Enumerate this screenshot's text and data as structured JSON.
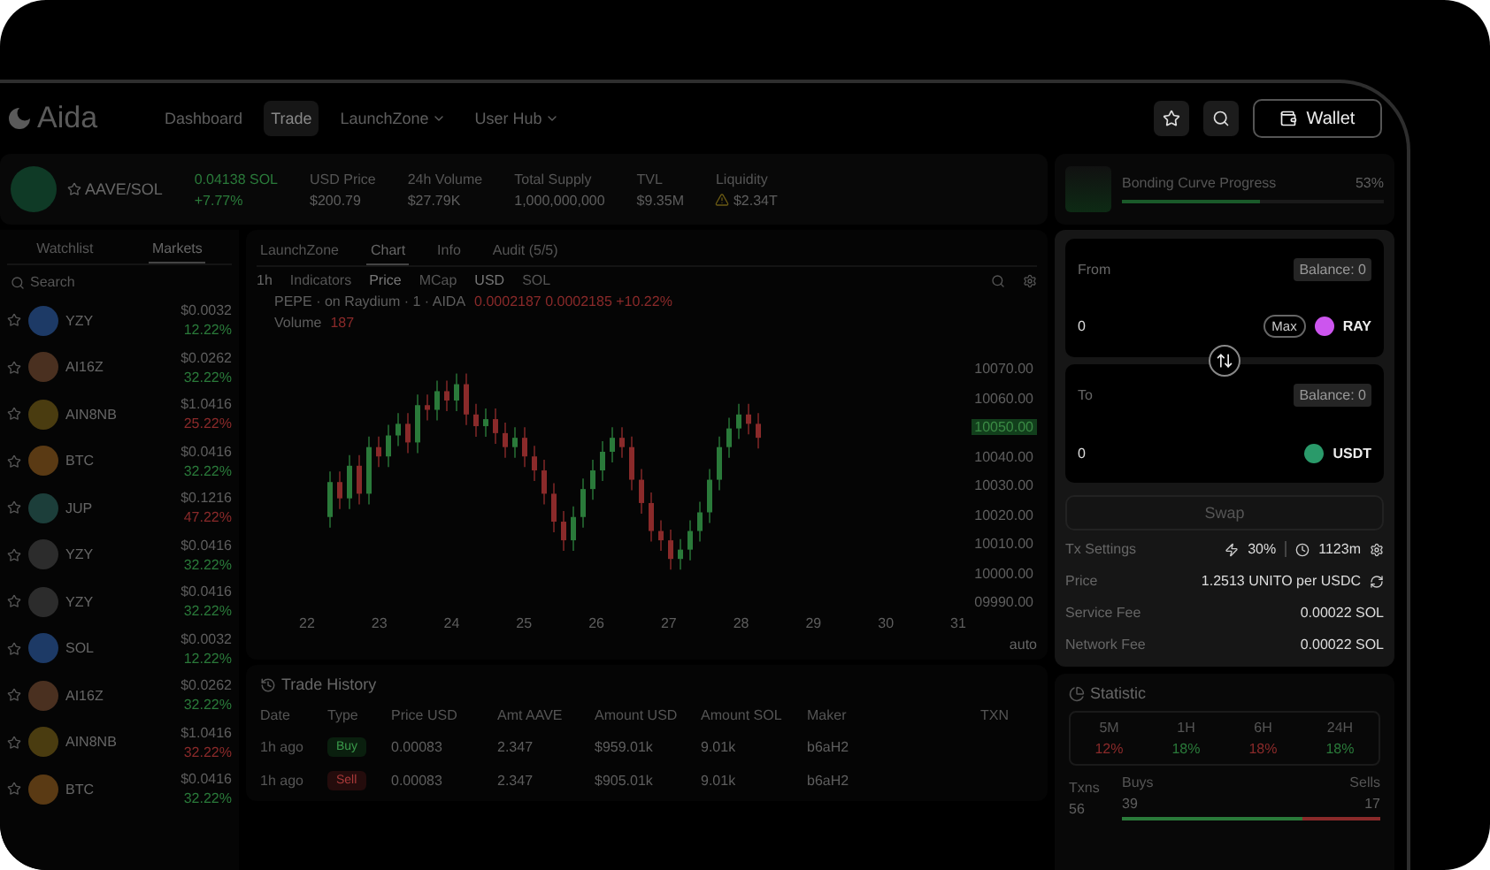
{
  "nav": {
    "logo": "Aida",
    "items": [
      {
        "label": "Dashboard",
        "selected": false,
        "dropdown": false
      },
      {
        "label": "Trade",
        "selected": true,
        "dropdown": false
      },
      {
        "label": "LaunchZone",
        "selected": false,
        "dropdown": true
      },
      {
        "label": "User Hub",
        "selected": false,
        "dropdown": true
      }
    ],
    "wallet_button": "Wallet"
  },
  "token": {
    "pair": "AAVE/SOL",
    "price": "0.04138 SOL",
    "change": "+7.77%",
    "stats": [
      {
        "label": "USD Price",
        "value": "$200.79",
        "warning": false
      },
      {
        "label": "24h Volume",
        "value": "$27.79K",
        "warning": false
      },
      {
        "label": "Total Supply",
        "value": "1,000,000,000",
        "warning": false
      },
      {
        "label": "TVL",
        "value": "$9.35M",
        "warning": false
      },
      {
        "label": "Liquidity",
        "value": "$2.34T",
        "warning": true
      }
    ]
  },
  "bonding_curve": {
    "label": "Bonding Curve Progress",
    "percent": "53%",
    "level": 0.53
  },
  "markets": {
    "tabs": [
      {
        "label": "Watchlist",
        "selected": false
      },
      {
        "label": "Markets",
        "selected": true
      }
    ],
    "search": {
      "placeholder": "Search"
    },
    "rows": [
      {
        "name": "YZY",
        "price": "$0.0032",
        "change": "12.22%",
        "up": true,
        "color": "#1d3a66"
      },
      {
        "name": "AI16Z",
        "price": "$0.0262",
        "change": "32.22%",
        "up": true,
        "color": "#4a3020"
      },
      {
        "name": "AIN8NB",
        "price": "$1.0416",
        "change": "25.22%",
        "up": false,
        "color": "#4a3c10"
      },
      {
        "name": "BTC",
        "price": "$0.0416",
        "change": "32.22%",
        "up": true,
        "color": "#5a3a14"
      },
      {
        "name": "JUP",
        "price": "$0.1216",
        "change": "47.22%",
        "up": false,
        "color": "#1c3e3a"
      },
      {
        "name": "YZY",
        "price": "$0.0416",
        "change": "32.22%",
        "up": true,
        "color": "#2c2c2c"
      },
      {
        "name": "YZY",
        "price": "$0.0416",
        "change": "32.22%",
        "up": true,
        "color": "#2c2c2c"
      },
      {
        "name": "SOL",
        "price": "$0.0032",
        "change": "12.22%",
        "up": true,
        "color": "#1d3a66"
      },
      {
        "name": "AI16Z",
        "price": "$0.0262",
        "change": "32.22%",
        "up": true,
        "color": "#4a3020"
      },
      {
        "name": "AIN8NB",
        "price": "$1.0416",
        "change": "32.22%",
        "up": false,
        "color": "#4a3c10"
      },
      {
        "name": "BTC",
        "price": "$0.0416",
        "change": "32.22%",
        "up": true,
        "color": "#5a3a14"
      }
    ]
  },
  "chart_panel": {
    "tabs": [
      {
        "label": "LaunchZone",
        "selected": false
      },
      {
        "label": "Chart",
        "selected": true
      },
      {
        "label": "Info",
        "selected": false
      },
      {
        "label": "Audit (5/5)",
        "selected": false
      }
    ],
    "interval": "1h",
    "indicators": "Indicators",
    "price_toggle": [
      {
        "label": "Price",
        "selected": true
      },
      {
        "label": "MCap",
        "selected": false
      }
    ],
    "currency_toggle": [
      {
        "label": "USD",
        "selected": true
      },
      {
        "label": "SOL",
        "selected": false
      }
    ],
    "legend": "PEPE · on Raydium · 1 · AIDA",
    "legend_values": "0.0002187 0.0002185 +10.22%",
    "volume_label": "Volume",
    "volume_value": "187",
    "y_ticks": [
      {
        "label": "10070.00",
        "current": false
      },
      {
        "label": "10060.00",
        "current": false
      },
      {
        "label": "10050.00",
        "current": true
      },
      {
        "label": "10040.00",
        "current": false
      },
      {
        "label": "10030.00",
        "current": false
      },
      {
        "label": "10020.00",
        "current": false
      },
      {
        "label": "10010.00",
        "current": false
      },
      {
        "label": "10000.00",
        "current": false
      },
      {
        "label": "09990.00",
        "current": false
      }
    ],
    "x_ticks": [
      "22",
      "23",
      "24",
      "25",
      "26",
      "27",
      "28",
      "29",
      "30",
      "31"
    ],
    "scale": "auto"
  },
  "trade_history": {
    "title": "Trade History",
    "columns": [
      "Date",
      "Type",
      "Price USD",
      "Amt AAVE",
      "Amount USD",
      "Amount SOL",
      "Maker",
      "TXN"
    ],
    "rows": [
      {
        "date": "1h ago",
        "type": "Buy",
        "buy": true,
        "price": "0.00083",
        "amount": "2.347",
        "usd": "$959.01k",
        "sol": "9.01k",
        "maker": "b6aH2"
      },
      {
        "date": "1h ago",
        "type": "Sell",
        "buy": false,
        "price": "0.00083",
        "amount": "2.347",
        "usd": "$905.01k",
        "sol": "9.01k",
        "maker": "b6aH2"
      }
    ]
  },
  "statistic": {
    "title": "Statistic",
    "periods": [
      {
        "label": "5M",
        "value": "12%",
        "up": false
      },
      {
        "label": "1H",
        "value": "18%",
        "up": true
      },
      {
        "label": "6H",
        "value": "18%",
        "up": false
      },
      {
        "label": "24H",
        "value": "18%",
        "up": true
      }
    ],
    "txns_label": "Txns",
    "txns": "56",
    "buys_label": "Buys",
    "buys": "39",
    "sells_label": "Sells",
    "sells": "17",
    "level": 0.7
  },
  "swap": {
    "from": {
      "label": "From",
      "balance": "Balance: 0",
      "amount": "0",
      "max": "Max",
      "token": "RAY",
      "color": "#cc55ee"
    },
    "to": {
      "label": "To",
      "balance": "Balance: 0",
      "amount": "0",
      "token": "USDT",
      "color": "#2a9a6a"
    },
    "button": "Swap",
    "details": [
      {
        "kind": "settings",
        "label": "Tx Settings",
        "slippage": "30%",
        "time": "1123m"
      },
      {
        "kind": "price",
        "label": "Price",
        "value": "1.2513 UNITO per USDC"
      },
      {
        "kind": "plain",
        "label": "Service Fee",
        "value": "0.00022 SOL"
      },
      {
        "kind": "plain",
        "label": "Network Fee",
        "value": "0.00022 SOL"
      }
    ]
  }
}
